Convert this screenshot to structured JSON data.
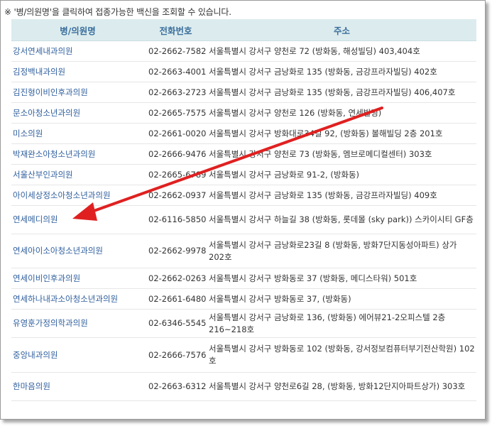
{
  "notice": "※ '병/의원명'을 클릭하여 접종가능한 백신을 조회할 수 있습니다.",
  "headers": {
    "name": "병/의원명",
    "phone": "전화번호",
    "address": "주소"
  },
  "rows": [
    {
      "name": "강서연세내과의원",
      "phone": "02-2662-7582",
      "address": "서울특별시 강서구 양천로 72 (방화동, 해성빌딩) 403,404호"
    },
    {
      "name": "김정백내과의원",
      "phone": "02-2663-4001",
      "address": "서울특별시 강서구 금낭화로 135 (방화동, 금강프라자빌딩) 402호"
    },
    {
      "name": "김진형이비인후과의원",
      "phone": "02-2663-2723",
      "address": "서울특별시 강서구 금낭화로 135 (방화동, 금강프라자빌딩) 406,407호"
    },
    {
      "name": "문소아청소년과의원",
      "phone": "02-2665-7575",
      "address": "서울특별시 강서구 양천로 126 (방화동, 연세빌딩)"
    },
    {
      "name": "미소의원",
      "phone": "02-2661-0020",
      "address": "서울특별시 강서구 방화대로34길 92, (방화동) 볼해빌딩 2층 201호"
    },
    {
      "name": "박재완소아청소년과의원",
      "phone": "02-2666-9476",
      "address": "서울특별시 강서구 양천로 73 (방화동, 멤브로메디컬센터) 303호"
    },
    {
      "name": "서울산부인과의원",
      "phone": "02-2665-6789",
      "address": "서울특별시 강서구 금낭화로 91-2, (방화동)"
    },
    {
      "name": "아이세상정소아청소년과의원",
      "phone": "02-2662-0937",
      "address": "서울특별시 강서구 금낭화로 135 (방화동, 금강프라자빌딩) 409호"
    },
    {
      "name": "연세메디의원",
      "phone": "02-6116-5850",
      "address": "서울특별시 강서구 하늘길 38 (방화동, 롯데몰 (sky park)) 스카이시티 GF층"
    },
    {
      "name": "연세아이소아청소년과의원",
      "phone": "02-2662-9978",
      "address": "서울특별시 강서구 금낭화로23길 8 (방화동, 방화7단지동성아파트) 상가 202호"
    },
    {
      "name": "연세이비인후과의원",
      "phone": "02-2662-0263",
      "address": "서울특별시 강서구 방화동로 37 (방화동, 메디스타워) 501호"
    },
    {
      "name": "연세하나내과소아청소년과의원",
      "phone": "02-2661-6480",
      "address": "서울특별시 강서구 방화동로 37, (방화동)"
    },
    {
      "name": "유영훈가정의학과의원",
      "phone": "02-6346-5545",
      "address": "서울특별시 강서구 금낭화로 136, (방화동) 에어뷰21-2오피스텔 2층 216~218호"
    },
    {
      "name": "중앙내과의원",
      "phone": "02-2666-7576",
      "address": "서울특별시 강서구 방화동로 102 (방화동, 강서정보컴퓨터부기전산학원) 102호"
    },
    {
      "name": "한마음의원",
      "phone": "02-2663-6312",
      "address": "서울특별시 강서구 양천로6길 28, (방화동, 방화12단지아파트상가) 303호"
    }
  ],
  "colors": {
    "header_bg": "#dcecee",
    "header_text": "#3b6e9c",
    "link": "#2f5f9e",
    "arrow": "#e02020"
  }
}
